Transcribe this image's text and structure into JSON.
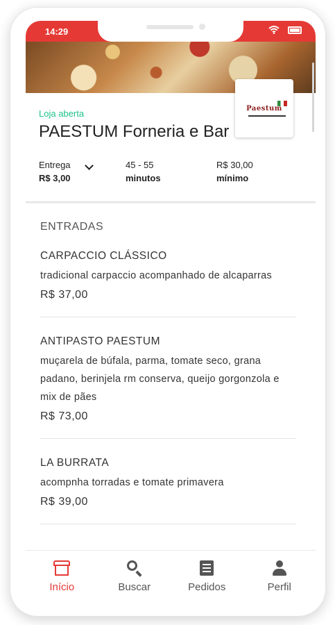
{
  "status_bar": {
    "time": "14:29",
    "wifi_icon": "wifi-icon",
    "battery_icon": "battery-icon"
  },
  "store": {
    "status": "Loja aberta",
    "name": "PAESTUM Forneria e Bar",
    "logo_text": "Paestum",
    "delivery_label": "Entrega",
    "delivery_fee": "R$ 3,00",
    "time_range": "45 - 55",
    "time_unit": "minutos",
    "minimum_value": "R$ 30,00",
    "minimum_label": "mínimo"
  },
  "menu": {
    "section_title": "ENTRADAS",
    "items": [
      {
        "name": "CARPACCIO CLÁSSICO",
        "description": "tradicional carpaccio acompanhado de alcaparras",
        "price": "R$ 37,00"
      },
      {
        "name": "ANTIPASTO PAESTUM",
        "description": "muçarela de búfala, parma, tomate seco, grana padano, berinjela rm conserva, queijo gorgonzola e mix de pães",
        "price": "R$ 73,00"
      },
      {
        "name": "LA BURRATA",
        "description": "acompnha torradas e tomate primavera",
        "price": "R$ 39,00"
      }
    ]
  },
  "bottom_nav": [
    {
      "label": "Início",
      "icon": "store-icon",
      "active": true
    },
    {
      "label": "Buscar",
      "icon": "search-icon",
      "active": false
    },
    {
      "label": "Pedidos",
      "icon": "orders-icon",
      "active": false
    },
    {
      "label": "Perfil",
      "icon": "profile-icon",
      "active": false
    }
  ],
  "colors": {
    "accent": "#e53935",
    "open_status": "#1ec28b",
    "text": "#333333"
  }
}
